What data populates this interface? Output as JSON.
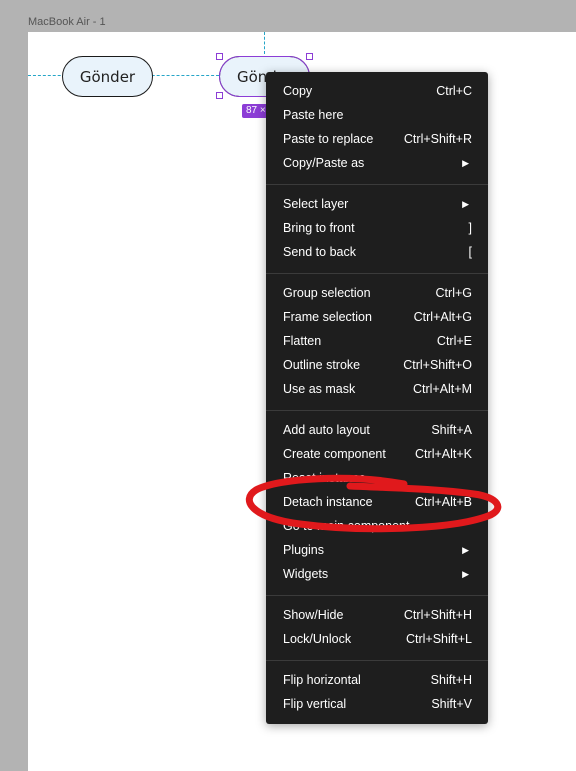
{
  "frame": {
    "title": "MacBook Air - 1"
  },
  "canvas": {
    "button1_label": "Gönder",
    "button2_label": "Gönd",
    "size_badge": "87 ×"
  },
  "context_menu": {
    "items": [
      {
        "label": "Copy",
        "shortcut": "Ctrl+C"
      },
      {
        "label": "Paste here",
        "shortcut": ""
      },
      {
        "label": "Paste to replace",
        "shortcut": "Ctrl+Shift+R"
      },
      {
        "label": "Copy/Paste as",
        "shortcut": "▶"
      },
      {
        "label": "Select layer",
        "shortcut": "▶"
      },
      {
        "label": "Bring to front",
        "shortcut": "]"
      },
      {
        "label": "Send to back",
        "shortcut": "["
      },
      {
        "label": "Group selection",
        "shortcut": "Ctrl+G"
      },
      {
        "label": "Frame selection",
        "shortcut": "Ctrl+Alt+G"
      },
      {
        "label": "Flatten",
        "shortcut": "Ctrl+E"
      },
      {
        "label": "Outline stroke",
        "shortcut": "Ctrl+Shift+O"
      },
      {
        "label": "Use as mask",
        "shortcut": "Ctrl+Alt+M"
      },
      {
        "label": "Add auto layout",
        "shortcut": "Shift+A"
      },
      {
        "label": "Create component",
        "shortcut": "Ctrl+Alt+K"
      },
      {
        "label": "Reset instance",
        "shortcut": ""
      },
      {
        "label": "Detach instance",
        "shortcut": "Ctrl+Alt+B"
      },
      {
        "label": "Go to main component",
        "shortcut": ""
      },
      {
        "label": "Plugins",
        "shortcut": "▶"
      },
      {
        "label": "Widgets",
        "shortcut": "▶"
      },
      {
        "label": "Show/Hide",
        "shortcut": "Ctrl+Shift+H"
      },
      {
        "label": "Lock/Unlock",
        "shortcut": "Ctrl+Shift+L"
      },
      {
        "label": "Flip horizontal",
        "shortcut": "Shift+H"
      },
      {
        "label": "Flip vertical",
        "shortcut": "Shift+V"
      }
    ]
  },
  "colors": {
    "selection": "#8c3dd6",
    "menu_bg": "#1e1e1e",
    "annotation": "#e0191c",
    "guide": "#25a5c8"
  }
}
